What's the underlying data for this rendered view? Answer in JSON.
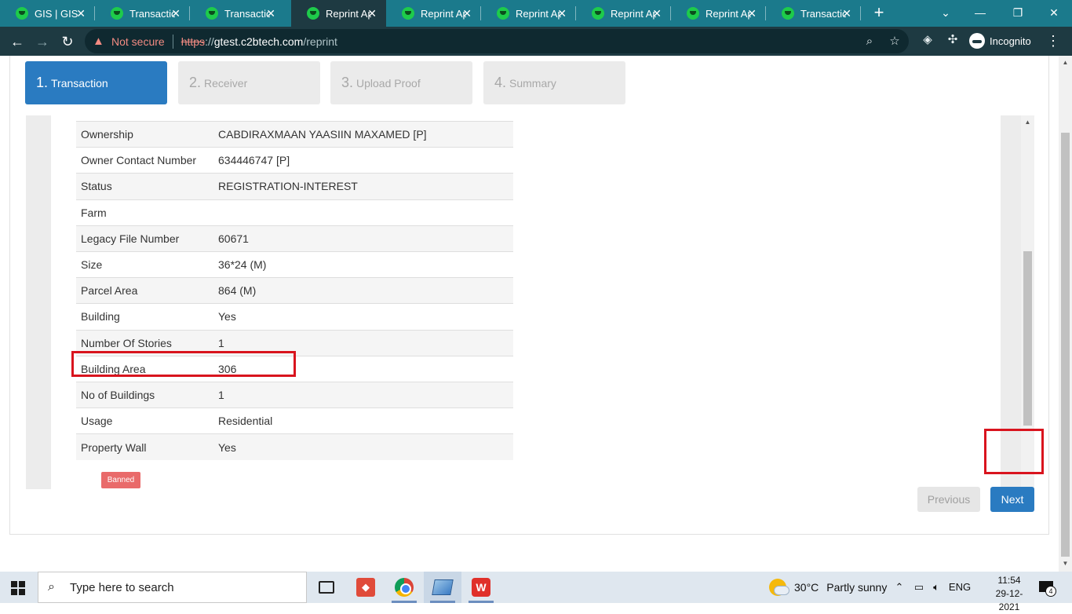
{
  "browser": {
    "tabs": [
      {
        "title": "GIS | GIS Portal",
        "active": false
      },
      {
        "title": "Transactions",
        "active": false
      },
      {
        "title": "Transactions",
        "active": false
      },
      {
        "title": "Reprint Application",
        "active": true
      },
      {
        "title": "Reprint Application",
        "active": false
      },
      {
        "title": "Reprint Application",
        "active": false
      },
      {
        "title": "Reprint Application",
        "active": false
      },
      {
        "title": "Reprint Application",
        "active": false
      },
      {
        "title": "Transactions",
        "active": false
      }
    ],
    "security_label": "Not secure",
    "url_scheme": "https",
    "url_sep": "://",
    "url_host": "gtest.c2btech.com",
    "url_path": "/reprint",
    "profile_label": "Incognito"
  },
  "wizard": {
    "steps": [
      {
        "num": "1.",
        "label": "Transaction",
        "active": true
      },
      {
        "num": "2.",
        "label": "Receiver",
        "active": false
      },
      {
        "num": "3.",
        "label": "Upload Proof",
        "active": false
      },
      {
        "num": "4.",
        "label": "Summary",
        "active": false
      }
    ],
    "properties": [
      {
        "key": "Ownership",
        "value": "CABDIRAXMAAN YAASIIN MAXAMED [P]"
      },
      {
        "key": "Owner Contact Number",
        "value": "634446747 [P]"
      },
      {
        "key": "Status",
        "value": "REGISTRATION-INTEREST"
      },
      {
        "key": "Farm",
        "value": ""
      },
      {
        "key": "Legacy File Number",
        "value": "60671"
      },
      {
        "key": "Size",
        "value": "36*24 (M)"
      },
      {
        "key": "Parcel Area",
        "value": "864 (M)"
      },
      {
        "key": "Building",
        "value": "Yes"
      },
      {
        "key": "Number Of Stories",
        "value": "1"
      },
      {
        "key": "Building Area",
        "value": "306"
      },
      {
        "key": "No of Buildings",
        "value": "1"
      },
      {
        "key": "Usage",
        "value": "Residential"
      },
      {
        "key": "Property Wall",
        "value": "Yes"
      }
    ],
    "badge": "Banned",
    "previous_label": "Previous",
    "next_label": "Next"
  },
  "taskbar": {
    "search_placeholder": "Type here to search",
    "temperature": "30°C",
    "weather": "Partly sunny",
    "language": "ENG",
    "time": "11:54",
    "date": "29-12-2021",
    "notification_count": "4"
  },
  "colors": {
    "tabstrip": "#1b7a8c",
    "toolbar": "#1e3a42",
    "wizard_active": "#2a7bc1",
    "highlight": "#d9141e",
    "banned": "#e96a6a"
  }
}
